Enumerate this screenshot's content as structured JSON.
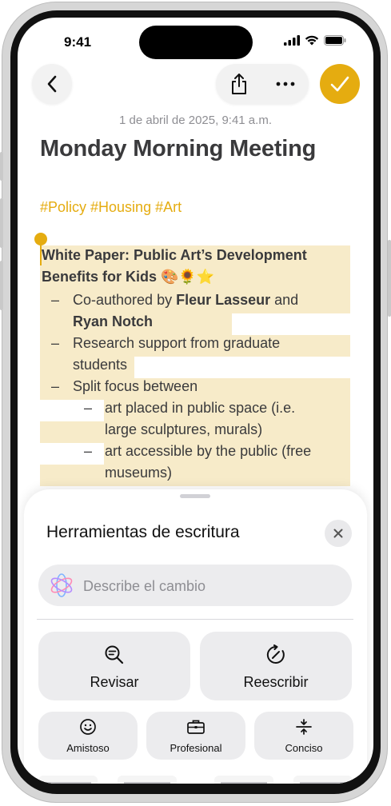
{
  "status": {
    "time": "9:41"
  },
  "note": {
    "date": "1 de abril de 2025, 9:41 a.m.",
    "title": "Monday Morning Meeting",
    "tags": "#Policy #Housing #Art",
    "line1": "White Paper: Public Art’s Development",
    "line2": "Benefits for Kids 🎨🌻⭐",
    "b1_pre": "Co-authored by ",
    "b1_bold": "Fleur Lasseur",
    "b1_post": " and",
    "b1_line2": "Ryan Notch",
    "b2_line1": "Research support from graduate",
    "b2_line2": "students",
    "b3": "Split focus between",
    "s1_line1": "art placed in public space (i.e.",
    "s1_line2": "large sculptures, murals)",
    "s2_line1": "art accessible by the public (free",
    "s2_line2": "museums)",
    "dash": "–"
  },
  "writing_tools": {
    "title": "Herramientas de escritura",
    "prompt_placeholder": "Describe el cambio",
    "proofread": "Revisar",
    "rewrite": "Reescribir",
    "friendly": "Amistoso",
    "professional": "Profesional",
    "concise": "Conciso"
  },
  "colors": {
    "accent": "#e5ac10",
    "highlight": "#f7ebc9"
  }
}
